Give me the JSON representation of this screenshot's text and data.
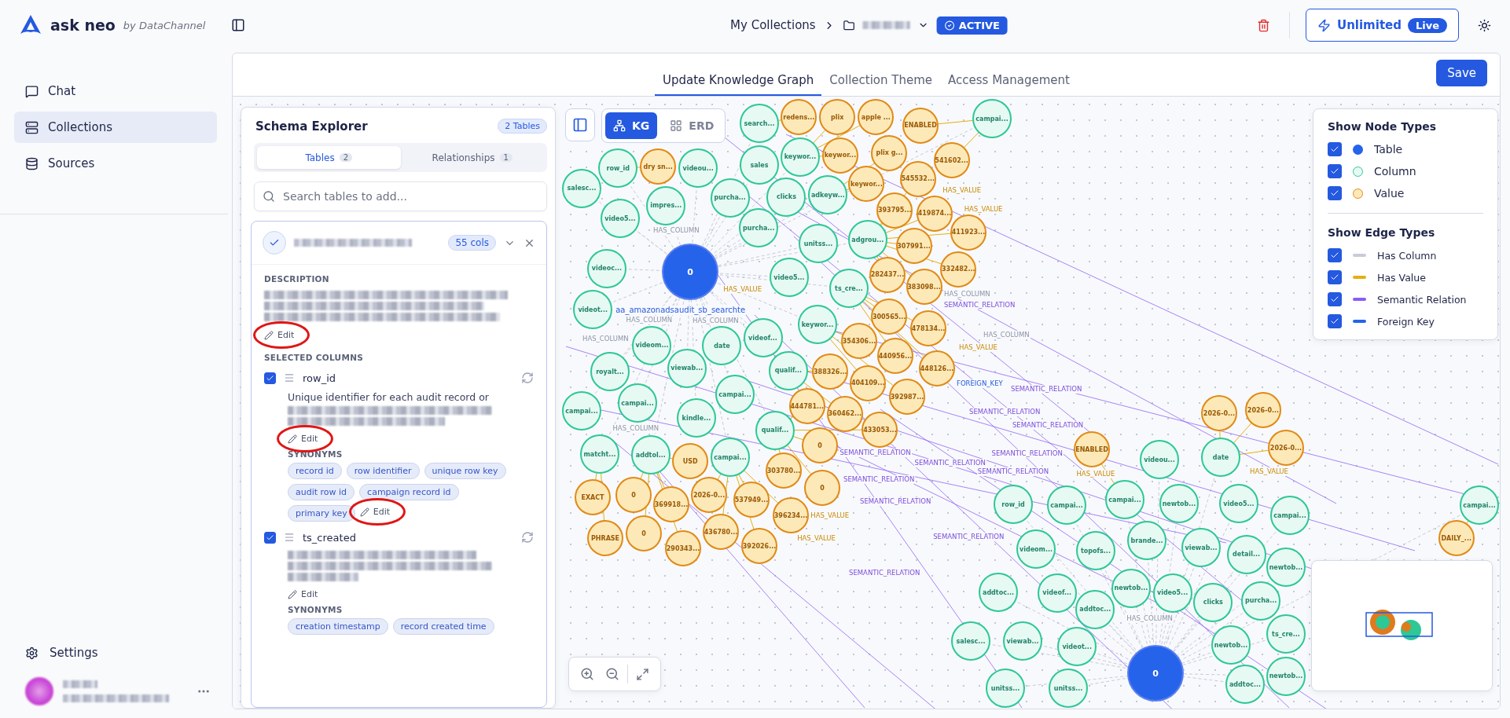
{
  "brand": {
    "name": "ask neo",
    "byline": "by DataChannel"
  },
  "breadcrumb": {
    "root": "My Collections",
    "status": "ACTIVE"
  },
  "plan": {
    "label": "Unlimited",
    "badge": "Live"
  },
  "sidebar": {
    "items": [
      {
        "label": "Chat",
        "selected": false
      },
      {
        "label": "Collections",
        "selected": true
      },
      {
        "label": "Sources",
        "selected": false
      }
    ],
    "settings": "Settings"
  },
  "tabs": [
    {
      "label": "Update Knowledge Graph",
      "selected": true
    },
    {
      "label": "Collection Theme",
      "selected": false
    },
    {
      "label": "Access Management",
      "selected": false
    }
  ],
  "save": "Save",
  "schema": {
    "title": "Schema Explorer",
    "badge": "2 Tables",
    "tabs": [
      {
        "label": "Tables",
        "count": "2",
        "selected": true
      },
      {
        "label": "Relationships",
        "count": "1",
        "selected": false
      }
    ],
    "search": {
      "placeholder": "Search tables to add..."
    },
    "table": {
      "cols": "55 cols",
      "description_label": "DESCRIPTION",
      "edit": "Edit",
      "edit_highlighted": true,
      "selected_label": "SELECTED COLUMNS",
      "columns": [
        {
          "name": "row_id",
          "checked": true,
          "description": "Unique identifier for each audit record or",
          "edit": "Edit",
          "edit_highlighted": true,
          "synonyms_label": "SYNONYMS",
          "synonyms": [
            "record id",
            "row identifier",
            "unique row key",
            "audit row id",
            "campaign record id",
            "primary key"
          ],
          "synonyms_edit": "Edit",
          "synonyms_edit_highlighted": true
        },
        {
          "name": "ts_created",
          "checked": true,
          "edit": "Edit",
          "edit_highlighted": false,
          "synonyms_label": "SYNONYMS",
          "synonyms": [
            "creation timestamp",
            "record created time"
          ]
        }
      ]
    }
  },
  "view_modes": [
    {
      "label": "KG",
      "selected": true
    },
    {
      "label": "ERD",
      "selected": false
    }
  ],
  "legend": {
    "node_title": "Show Node Types",
    "node_types": [
      {
        "label": "Table",
        "kind": "table",
        "checked": true
      },
      {
        "label": "Column",
        "kind": "column",
        "checked": true
      },
      {
        "label": "Value",
        "kind": "value",
        "checked": true
      }
    ],
    "edge_title": "Show Edge Types",
    "edge_types": [
      {
        "label": "Has Column",
        "kind": "has_column",
        "checked": true
      },
      {
        "label": "Has Value",
        "kind": "has_value",
        "checked": true
      },
      {
        "label": "Semantic Relation",
        "kind": "semantic",
        "checked": true
      },
      {
        "label": "Foreign Key",
        "kind": "foreign_key",
        "checked": true
      }
    ]
  },
  "graph": {
    "table_caption": "aa_amazonadsaudit_sb_searchte",
    "nodes": [
      {
        "kind": "table",
        "label": "0"
      },
      {
        "kind": "table",
        "label": "0"
      },
      {
        "kind": "column",
        "label": "campai..."
      },
      {
        "kind": "value",
        "label": "dry sn..."
      },
      {
        "kind": "column",
        "label": "search..."
      },
      {
        "kind": "value",
        "label": "redens..."
      },
      {
        "kind": "column",
        "label": "row_id"
      },
      {
        "kind": "column",
        "label": "salesc..."
      },
      {
        "kind": "column",
        "label": "impres..."
      },
      {
        "kind": "column",
        "label": "video5..."
      },
      {
        "kind": "column",
        "label": "videou..."
      },
      {
        "kind": "column",
        "label": "sales"
      },
      {
        "kind": "column",
        "label": "purcha..."
      },
      {
        "kind": "column",
        "label": "purcha..."
      },
      {
        "kind": "column",
        "label": "keywor..."
      },
      {
        "kind": "column",
        "label": "clicks"
      },
      {
        "kind": "column",
        "label": "adkeyw..."
      },
      {
        "kind": "column",
        "label": "unitss..."
      },
      {
        "kind": "column",
        "label": "video5..."
      },
      {
        "kind": "column",
        "label": "ts_cre..."
      },
      {
        "kind": "column",
        "label": "adgrou..."
      },
      {
        "kind": "column",
        "label": "videoc..."
      },
      {
        "kind": "column",
        "label": "videot..."
      },
      {
        "kind": "column",
        "label": "videom..."
      },
      {
        "kind": "column",
        "label": "date"
      },
      {
        "kind": "column",
        "label": "videof..."
      },
      {
        "kind": "column",
        "label": "keywor..."
      },
      {
        "kind": "column",
        "label": "viewab..."
      },
      {
        "kind": "column",
        "label": "royalt..."
      },
      {
        "kind": "column",
        "label": "qualif..."
      },
      {
        "kind": "column",
        "label": "campai..."
      },
      {
        "kind": "column",
        "label": "campai..."
      },
      {
        "kind": "column",
        "label": "kindle..."
      },
      {
        "kind": "column",
        "label": "qualif..."
      },
      {
        "kind": "column",
        "label": "campai..."
      },
      {
        "kind": "value",
        "label": "plix"
      },
      {
        "kind": "value",
        "label": "apple ..."
      },
      {
        "kind": "value",
        "label": "plix g..."
      },
      {
        "kind": "value",
        "label": "ENABLED"
      },
      {
        "kind": "value",
        "label": "keywor..."
      },
      {
        "kind": "value",
        "label": "keywor..."
      },
      {
        "kind": "value",
        "label": "545532..."
      },
      {
        "kind": "value",
        "label": "541602..."
      },
      {
        "kind": "value",
        "label": "393795..."
      },
      {
        "kind": "value",
        "label": "419874..."
      },
      {
        "kind": "value",
        "label": "411923..."
      },
      {
        "kind": "value",
        "label": "307991..."
      },
      {
        "kind": "value",
        "label": "332482..."
      },
      {
        "kind": "value",
        "label": "282437..."
      },
      {
        "kind": "value",
        "label": "383098..."
      },
      {
        "kind": "value",
        "label": "300565..."
      },
      {
        "kind": "value",
        "label": "478134..."
      },
      {
        "kind": "value",
        "label": "354306..."
      },
      {
        "kind": "value",
        "label": "440956..."
      },
      {
        "kind": "value",
        "label": "448126..."
      },
      {
        "kind": "value",
        "label": "388326..."
      },
      {
        "kind": "value",
        "label": "404109..."
      },
      {
        "kind": "value",
        "label": "392987..."
      },
      {
        "kind": "value",
        "label": "444781..."
      },
      {
        "kind": "value",
        "label": "360462..."
      },
      {
        "kind": "value",
        "label": "433053..."
      },
      {
        "kind": "column",
        "label": "matcht..."
      },
      {
        "kind": "column",
        "label": "addtol..."
      },
      {
        "kind": "value",
        "label": "USD"
      },
      {
        "kind": "column",
        "label": "campai..."
      },
      {
        "kind": "value",
        "label": "EXACT"
      },
      {
        "kind": "value",
        "label": "0"
      },
      {
        "kind": "value",
        "label": "369918..."
      },
      {
        "kind": "value",
        "label": "2026-0..."
      },
      {
        "kind": "value",
        "label": "537949..."
      },
      {
        "kind": "value",
        "label": "396234..."
      },
      {
        "kind": "value",
        "label": "PHRASE"
      },
      {
        "kind": "value",
        "label": "0"
      },
      {
        "kind": "value",
        "label": "290343..."
      },
      {
        "kind": "value",
        "label": "436780..."
      },
      {
        "kind": "value",
        "label": "392026..."
      },
      {
        "kind": "value",
        "label": "0"
      },
      {
        "kind": "value",
        "label": "303780..."
      },
      {
        "kind": "value",
        "label": "0"
      },
      {
        "kind": "value",
        "label": "ENABLED"
      },
      {
        "kind": "value",
        "label": "2026-0..."
      },
      {
        "kind": "value",
        "label": "2026-0..."
      },
      {
        "kind": "value",
        "label": "2026-0..."
      },
      {
        "kind": "column",
        "label": "videou..."
      },
      {
        "kind": "column",
        "label": "date"
      },
      {
        "kind": "column",
        "label": "row_id"
      },
      {
        "kind": "column",
        "label": "campai..."
      },
      {
        "kind": "column",
        "label": "campai..."
      },
      {
        "kind": "column",
        "label": "newtob..."
      },
      {
        "kind": "column",
        "label": "video5..."
      },
      {
        "kind": "column",
        "label": "campai..."
      },
      {
        "kind": "column",
        "label": "videom..."
      },
      {
        "kind": "column",
        "label": "topofs..."
      },
      {
        "kind": "column",
        "label": "brande..."
      },
      {
        "kind": "column",
        "label": "viewab..."
      },
      {
        "kind": "column",
        "label": "detail..."
      },
      {
        "kind": "column",
        "label": "newtob..."
      },
      {
        "kind": "column",
        "label": "addtoc..."
      },
      {
        "kind": "column",
        "label": "videof..."
      },
      {
        "kind": "column",
        "label": "newtob..."
      },
      {
        "kind": "column",
        "label": "addtoc..."
      },
      {
        "kind": "column",
        "label": "video5..."
      },
      {
        "kind": "column",
        "label": "clicks"
      },
      {
        "kind": "column",
        "label": "purcha..."
      },
      {
        "kind": "column",
        "label": "salesc..."
      },
      {
        "kind": "column",
        "label": "viewab..."
      },
      {
        "kind": "column",
        "label": "videot..."
      },
      {
        "kind": "column",
        "label": "newtob..."
      },
      {
        "kind": "column",
        "label": "ts_cre..."
      },
      {
        "kind": "column",
        "label": "addtoc..."
      },
      {
        "kind": "column",
        "label": "newtob..."
      },
      {
        "kind": "column",
        "label": "unitss..."
      },
      {
        "kind": "column",
        "label": "unitss..."
      },
      {
        "kind": "value",
        "label": "DAILY_..."
      },
      {
        "kind": "column",
        "label": "campai..."
      }
    ],
    "edge_labels": [
      {
        "kind": "has_column",
        "text": "HAS_COLUMN"
      },
      {
        "kind": "has_column",
        "text": "HAS_COLUMN"
      },
      {
        "kind": "has_column",
        "text": "HAS_COLUMN"
      },
      {
        "kind": "has_column",
        "text": "HAS_COLUMN"
      },
      {
        "kind": "has_column",
        "text": "HAS_COLUMN"
      },
      {
        "kind": "has_column",
        "text": "HAS_COLUMN"
      },
      {
        "kind": "has_column",
        "text": "HAS_COLUMN"
      },
      {
        "kind": "has_column",
        "text": "HAS_COLUMN"
      },
      {
        "kind": "has_value",
        "text": "HAS_VALUE"
      },
      {
        "kind": "has_value",
        "text": "HAS_VALUE"
      },
      {
        "kind": "has_value",
        "text": "HAS_VALUE"
      },
      {
        "kind": "has_value",
        "text": "HAS_VALUE"
      },
      {
        "kind": "has_value",
        "text": "HAS_VALUE"
      },
      {
        "kind": "has_value",
        "text": "HAS_VALUE"
      },
      {
        "kind": "has_value",
        "text": "HAS_VALUE"
      },
      {
        "kind": "has_value",
        "text": "HAS_VALUE"
      },
      {
        "kind": "semantic",
        "text": "SEMANTIC_RELATION"
      },
      {
        "kind": "semantic",
        "text": "SEMANTIC_RELATION"
      },
      {
        "kind": "semantic",
        "text": "SEMANTIC_RELATION"
      },
      {
        "kind": "semantic",
        "text": "SEMANTIC_RELATION"
      },
      {
        "kind": "semantic",
        "text": "SEMANTIC_RELATION"
      },
      {
        "kind": "semantic",
        "text": "SEMANTIC_RELATION"
      },
      {
        "kind": "semantic",
        "text": "SEMANTIC_RELATION"
      },
      {
        "kind": "semantic",
        "text": "SEMANTIC_RELATION"
      },
      {
        "kind": "semantic",
        "text": "SEMANTIC_RELATION"
      },
      {
        "kind": "semantic",
        "text": "SEMANTIC_RELATION"
      },
      {
        "kind": "semantic",
        "text": "SEMANTIC_RELATION"
      },
      {
        "kind": "semantic",
        "text": "SEMANTIC_RELATION"
      },
      {
        "kind": "foreign_key",
        "text": "FOREIGN_KEY"
      }
    ]
  }
}
